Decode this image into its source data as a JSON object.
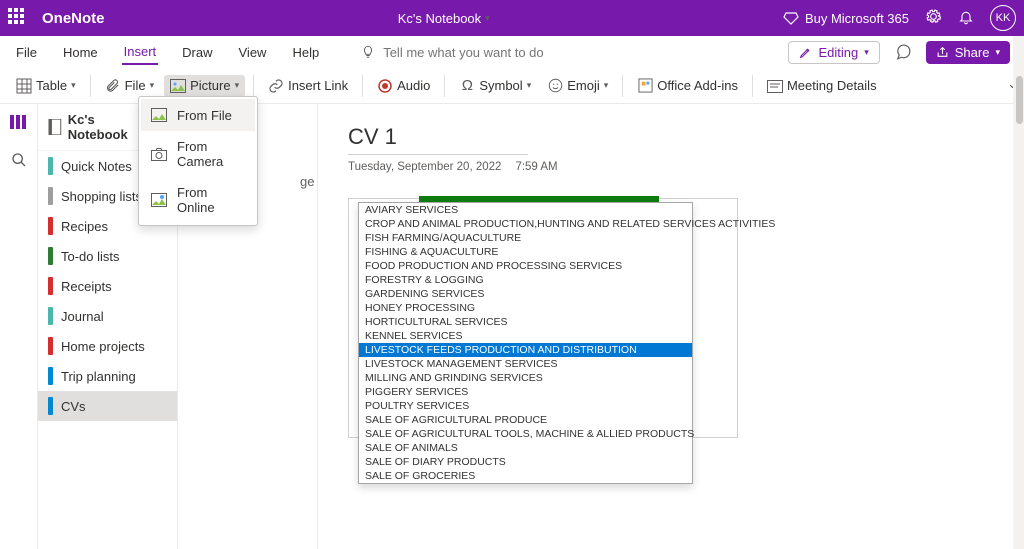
{
  "titlebar": {
    "app_name": "OneNote",
    "notebook_title": "Kc's Notebook",
    "buy_label": "Buy Microsoft 365",
    "avatar_initials": "KK"
  },
  "menubar": {
    "items": [
      "File",
      "Home",
      "Insert",
      "Draw",
      "View",
      "Help"
    ],
    "active_index": 2,
    "search_placeholder": "Tell me what you want to do",
    "editing_label": "Editing",
    "share_label": "Share"
  },
  "ribbon": {
    "table": "Table",
    "file": "File",
    "picture": "Picture",
    "insert_link": "Insert Link",
    "audio": "Audio",
    "symbol": "Symbol",
    "emoji": "Emoji",
    "office_addins": "Office Add-ins",
    "meeting_details": "Meeting Details"
  },
  "picture_menu": {
    "from_file": "From File",
    "from_camera": "From Camera",
    "from_online": "From Online"
  },
  "sidebar": {
    "notebook": "Kc's Notebook",
    "sections": [
      {
        "label": "Quick Notes",
        "color": "#4DB6AC"
      },
      {
        "label": "Shopping lists",
        "color": "#9E9E9E"
      },
      {
        "label": "Recipes",
        "color": "#D32F2F"
      },
      {
        "label": "To-do lists",
        "color": "#2E7D32"
      },
      {
        "label": "Receipts",
        "color": "#D32F2F"
      },
      {
        "label": "Journal",
        "color": "#4DB6AC"
      },
      {
        "label": "Home projects",
        "color": "#D32F2F"
      },
      {
        "label": "Trip planning",
        "color": "#0288D1"
      },
      {
        "label": "CVs",
        "color": "#0288D1"
      }
    ],
    "selected_index": 8,
    "page_hint": "ge"
  },
  "page": {
    "title": "CV 1",
    "date": "Tuesday, September 20, 2022",
    "time": "7:59 AM"
  },
  "dropdown": {
    "items": [
      "AVIARY SERVICES",
      "CROP AND ANIMAL PRODUCTION,HUNTING AND RELATED SERVICES ACTIVITIES",
      "FISH FARMING/AQUACULTURE",
      "FISHING & AQUACULTURE",
      "FOOD PRODUCTION AND PROCESSING SERVICES",
      "FORESTRY & LOGGING",
      "GARDENING SERVICES",
      "HONEY PROCESSING",
      "HORTICULTURAL SERVICES",
      "KENNEL SERVICES",
      "LIVESTOCK FEEDS PRODUCTION AND DISTRIBUTION",
      "LIVESTOCK MANAGEMENT SERVICES",
      "MILLING AND GRINDING SERVICES",
      "PIGGERY SERVICES",
      "POULTRY SERVICES",
      "SALE OF AGRICULTURAL PRODUCE",
      "SALE OF AGRICULTURAL TOOLS, MACHINE & ALLIED PRODUCTS",
      "SALE OF ANIMALS",
      "SALE OF DIARY PRODUCTS",
      "SALE OF GROCERIES"
    ],
    "highlighted_index": 10
  }
}
